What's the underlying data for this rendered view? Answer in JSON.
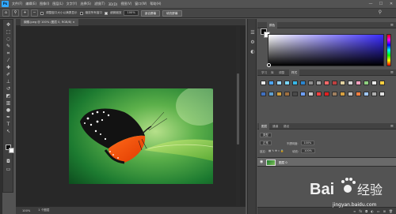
{
  "menubar": {
    "logo": "Ps",
    "items": [
      "文件(F)",
      "编辑(E)",
      "图像(I)",
      "图层(L)",
      "文字(Y)",
      "选择(S)",
      "滤镜(T)",
      "3D(D)",
      "视图(V)",
      "窗口(W)",
      "帮助(H)"
    ],
    "window_controls": [
      "—",
      "☐",
      "✕"
    ]
  },
  "options_bar": {
    "checkbox1_label": "调整窗口大小以满屏显示",
    "checkbox2_label": "缩放所有窗口",
    "checkbox3_label": "细微缩放",
    "zoom_value": "100%",
    "fit_button": "适合屏幕",
    "fill_button": "填充屏幕"
  },
  "document": {
    "tab_title": "蝴蝶.jpeg @ 100% (图层 0, RGB/8) ×",
    "status_zoom": "100%",
    "status_info": "1 个图层"
  },
  "color_panel": {
    "tab_active": "颜色",
    "tab_other": "色板",
    "fg_color": "#000000",
    "bg_color": "#ffffff",
    "accent_hue": "#3a2bff"
  },
  "style_panel": {
    "tabs": [
      "学习",
      "库",
      "调整",
      "样式"
    ],
    "active_tab": "样式",
    "row1": [
      "#e8e8e8",
      "#4da6ff",
      "#9ad4ff",
      "#7ad6ff",
      "#37b8e8",
      "#2a86d0",
      "#8f8f8f",
      "#aaaaaa",
      "#ff6a6a",
      "#c04040",
      "#dfd0a0",
      "#d4d4d4",
      "#ffa0c0",
      "#8fd080",
      "#e8e8e8",
      "#ffcf40"
    ],
    "row2": [
      "#4070c0",
      "#60a0d0",
      "#d0a040",
      "#a07040",
      "#4a4a4a",
      "#6fa0ff",
      "#c8c8c8",
      "#ff4040",
      "#e02020",
      "#a08060",
      "#d8a040",
      "#c0c0c0",
      "#ff8040",
      "#a0c8ff",
      "#b0b0b0",
      "#e0e0e0"
    ]
  },
  "layers_panel": {
    "tabs": [
      "图层",
      "通道",
      "路径"
    ],
    "active_tab": "图层",
    "search_label": "类型",
    "blend_mode": "正常",
    "opacity_label": "不透明度:",
    "opacity_value": "100%",
    "lock_label": "锁定:",
    "fill_label": "填充:",
    "fill_value": "100%",
    "layer_name": "图层 0"
  },
  "watermark": {
    "brand": "Bai",
    "brand2": "经验",
    "url": "jingyan.baidu.com"
  }
}
